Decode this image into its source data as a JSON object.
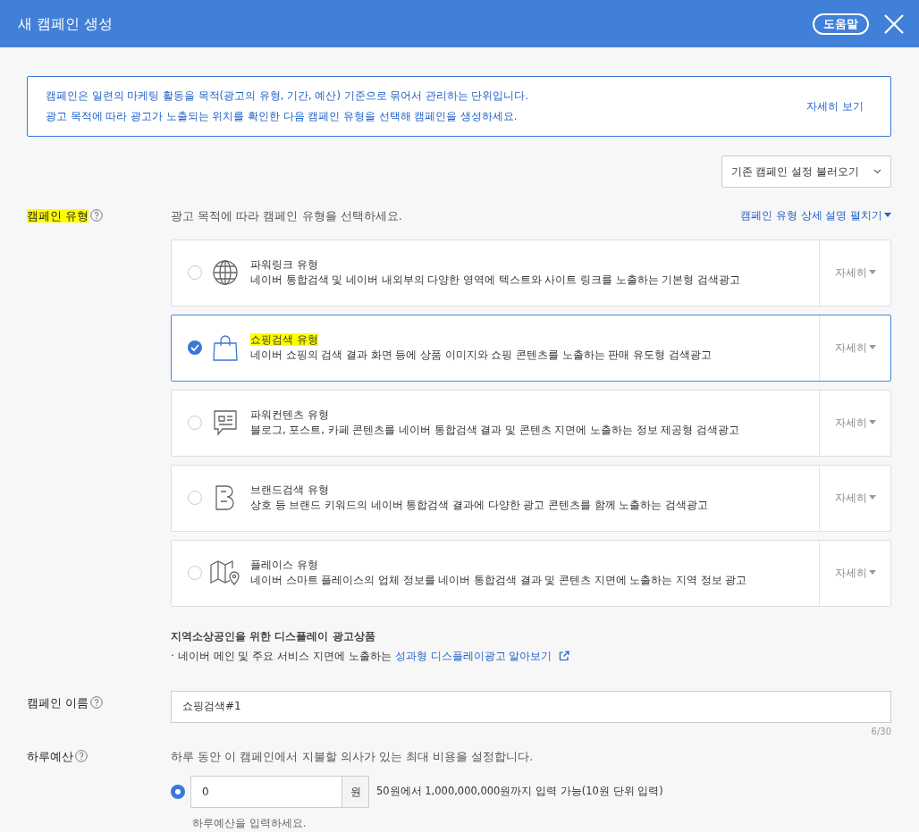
{
  "window": {
    "title": "새 캠페인 생성",
    "help_button": "도움말"
  },
  "info": {
    "lines": [
      "캠페인은 일련의 마케팅 활동을 목적(광고의 유형, 기간, 예산) 기준으로 묶어서 관리하는 단위입니다.",
      "광고 목적에 따라 광고가 노출되는 위치를 확인한 다음 캠페인 유형을 선택해 캠페인을 생성하세요."
    ],
    "link": "자세히 보기"
  },
  "load_settings": "기존 캠페인 설정 불러오기",
  "campaign_type": {
    "label": "캠페인 유형",
    "highlighted": true,
    "hint": "광고 목적에 따라 캠페인 유형을 선택하세요.",
    "expand_link": "캠페인 유형 상세 설명 펼치기",
    "options": [
      {
        "kind": "globe",
        "title": "파워링크 유형",
        "description": "네이버 통합검색 및 네이버 내외부의 다양한 영역에 텍스트와 사이트 링크를 노출하는 기본형 검색광고",
        "details": "자세히",
        "selected": false,
        "highlighted": false
      },
      {
        "kind": "bag",
        "title": "쇼핑검색 유형",
        "description": "네이버 쇼핑의 검색 결과 화면 등에 상품 이미지와 쇼핑 콘텐츠를 노출하는 판매 유도형 검색광고",
        "details": "자세히",
        "selected": true,
        "highlighted": true
      },
      {
        "kind": "chat",
        "title": "파워컨텐츠 유형",
        "description": "블로그, 포스트, 카페 콘텐츠를 네이버 통합검색 결과 및 콘텐츠 지면에 노출하는 정보 제공형 검색광고",
        "details": "자세히",
        "selected": false,
        "highlighted": false
      },
      {
        "kind": "brand",
        "title": "브랜드검색 유형",
        "description": "상호 등 브랜드 키워드의 네이버 통합검색 결과에 다양한 광고 콘텐츠를 함께 노출하는 검색광고",
        "details": "자세히",
        "selected": false,
        "highlighted": false
      },
      {
        "kind": "map",
        "title": "플레이스 유형",
        "description": "네이버 스마트 플레이스의 업체 정보를 네이버 통합검색 결과 및 콘텐츠 지면에 노출하는 지역 정보 광고",
        "details": "자세히",
        "selected": false,
        "highlighted": false
      }
    ],
    "display_note": {
      "title": "지역소상공인을 위한 디스플레이 광고상품",
      "bullet": "·",
      "text": "네이버 메인 및 주요 서비스 지면에 노출하는",
      "link": "성과형 디스플레이광고 알아보기"
    }
  },
  "campaign_name": {
    "label": "캠페인 이름",
    "value": "쇼핑검색#1",
    "counter": "6/30"
  },
  "daily_budget": {
    "label": "하루예산",
    "hint": "하루 동안 이 캠페인에서 지불할 의사가 있는 최대 비용을 설정합니다.",
    "selected": true,
    "value": "0",
    "unit": "원",
    "range_note": "50원에서 1,000,000,000원까지 입력 가능(10원 단위 입력)",
    "error": "하루예산을 입력하세요."
  }
}
